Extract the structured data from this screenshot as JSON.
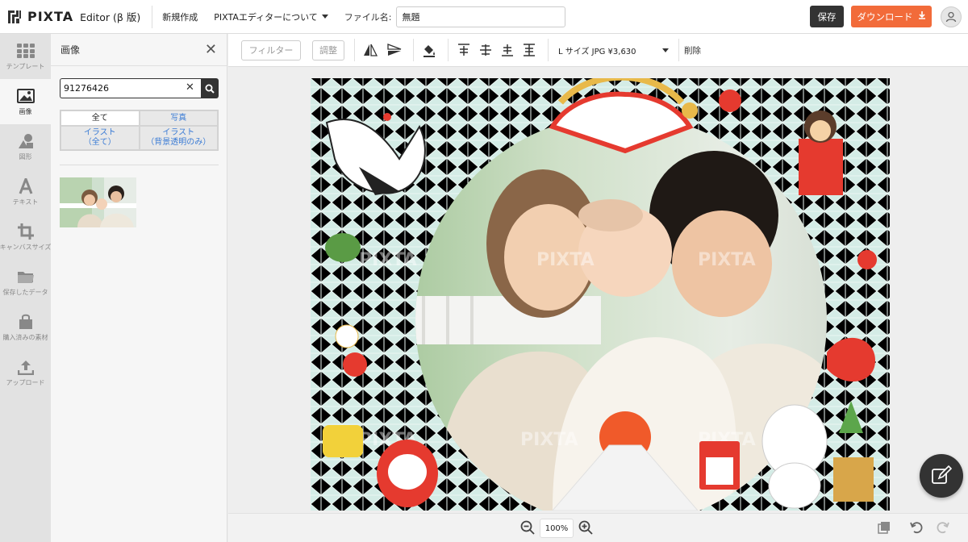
{
  "header": {
    "logo_text": "PIXTA",
    "editor_label": "Editor (β 版)",
    "nav_new": "新規作成",
    "nav_about": "PIXTAエディターについて",
    "filename_label": "ファイル名:",
    "filename_value": "無題",
    "save_label": "保存",
    "download_label": "ダウンロード"
  },
  "rail": {
    "items": [
      {
        "label": "テンプレート",
        "icon": "grid-icon"
      },
      {
        "label": "画像",
        "icon": "image-icon"
      },
      {
        "label": "図形",
        "icon": "shapes-icon"
      },
      {
        "label": "テキスト",
        "icon": "text-icon"
      },
      {
        "label": "キャンバスサイズ",
        "icon": "crop-icon"
      },
      {
        "label": "保存したデータ",
        "icon": "folder-icon"
      },
      {
        "label": "購入済みの素材",
        "icon": "shopping-bag-icon"
      },
      {
        "label": "アップロード",
        "icon": "upload-icon"
      }
    ],
    "active_index": 1
  },
  "panel": {
    "title": "画像",
    "search_value": "91276426",
    "tabs": [
      {
        "label": "全て"
      },
      {
        "label": "写真"
      },
      {
        "label": "イラスト\n（全て）"
      },
      {
        "label": "イラスト\n（背景透明のみ）"
      }
    ]
  },
  "toolbar": {
    "filter_label": "フィルター",
    "adjust_label": "調整",
    "size_label": "L サイズ JPG ¥3,630",
    "delete_label": "削除"
  },
  "canvas": {
    "watermark": "PIXTA"
  },
  "bottombar": {
    "zoom_value": "100%"
  },
  "colors": {
    "accent_orange": "#f26b3a",
    "dark": "#333333",
    "link_blue": "#3a7bd5",
    "frame_mint": "#cfe9e3"
  }
}
